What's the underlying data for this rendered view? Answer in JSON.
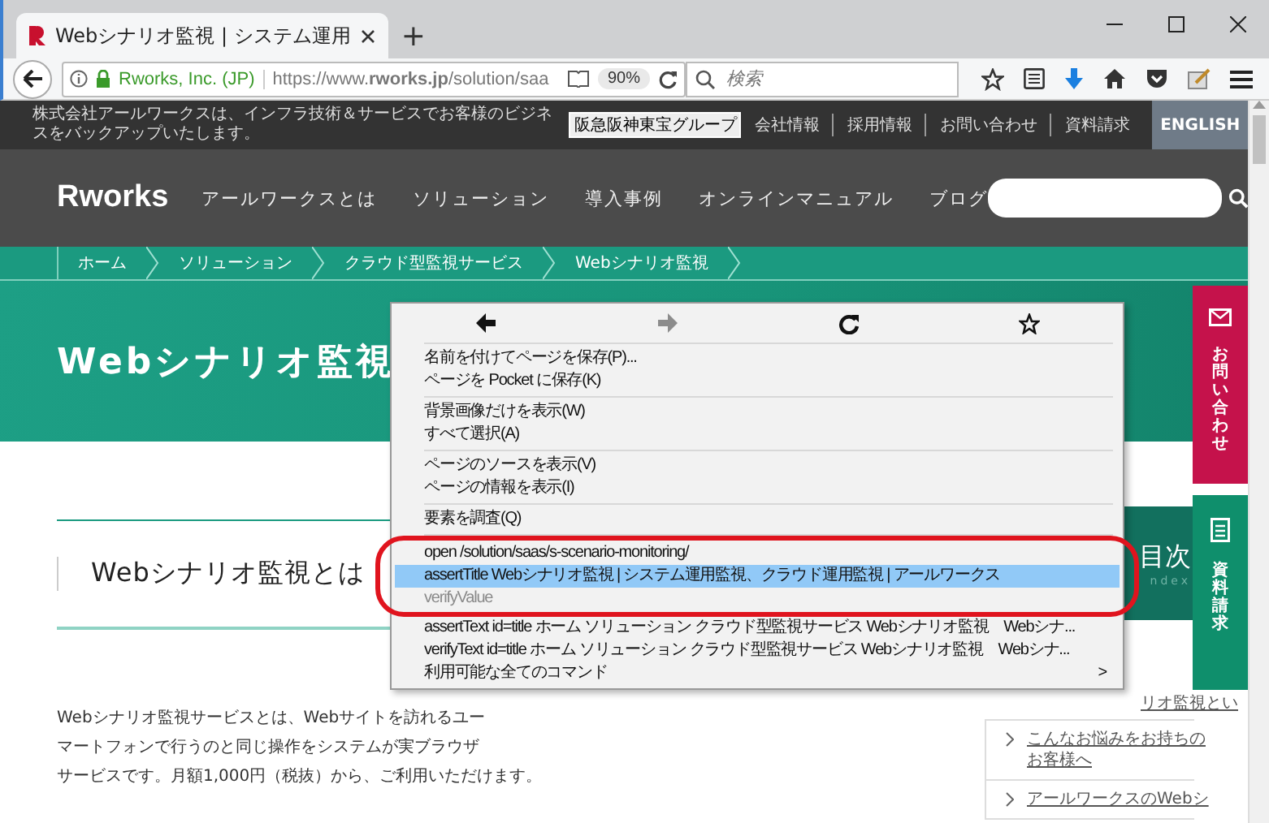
{
  "browser": {
    "tab_title": "Webシナリオ監視 | システム運用",
    "new_tab": "+",
    "site_identity": "Rworks, Inc. (JP)",
    "url": "https://www.**rworks.jp**/solution/saa",
    "zoom": "90%",
    "search_placeholder": "検索"
  },
  "top_bar": {
    "tagline": "株式会社アールワークスは、インフラ技術＆サービスでお客様のビジネスをバックアップいたします。",
    "group_badge": "阪急阪神東宝グループ",
    "links": [
      "会社情報",
      "採用情報",
      "お問い合わせ",
      "資料請求"
    ],
    "language": "ENGLISH"
  },
  "header": {
    "logo": "Rworks",
    "nav": [
      "アールワークスとは",
      "ソリューション",
      "導入事例",
      "オンラインマニュアル",
      "ブログ"
    ]
  },
  "breadcrumb": [
    "ホーム",
    "ソリューション",
    "クラウド型監視サービス",
    "Webシナリオ監視"
  ],
  "hero": {
    "title": "Webシナリオ監視"
  },
  "section": {
    "heading": "Webシナリオ監視とは",
    "paragraph_lines": [
      "Webシナリオ監視サービスとは、Webサイトを訪れるユー",
      "マートフォンで行うのと同じ操作をシステムが実ブラウザ",
      "サービスです。月額1,000円（税抜）から、ご利用いただけます。"
    ]
  },
  "toc": {
    "title": "目次",
    "subtitle": "ndex",
    "items": [
      "リオ監視とい",
      "こんなお悩みをお持ちのお客様へ",
      "アールワークスのWebシ"
    ]
  },
  "side_tabs": [
    {
      "label": "お問い合わせ",
      "kind": "mail",
      "color": "#c5124b"
    },
    {
      "label": "資料請求",
      "kind": "document",
      "color": "#0f8f6c"
    }
  ],
  "context_menu": {
    "nav_buttons": [
      {
        "kind": "back",
        "disabled": false
      },
      {
        "kind": "forward",
        "disabled": true
      },
      {
        "kind": "reload",
        "disabled": false
      },
      {
        "kind": "bookmark",
        "disabled": false
      }
    ],
    "groups": [
      {
        "items": [
          {
            "label": "名前を付けてページを保存(P)...",
            "selected": false,
            "disabled": false,
            "circled": false
          },
          {
            "label": "ページを Pocket に保存(K)",
            "selected": false,
            "disabled": false,
            "circled": false
          }
        ]
      },
      {
        "items": [
          {
            "label": "背景画像だけを表示(W)",
            "selected": false,
            "disabled": false,
            "circled": false
          },
          {
            "label": "すべて選択(A)",
            "selected": false,
            "disabled": false,
            "circled": false
          }
        ]
      },
      {
        "items": [
          {
            "label": "ページのソースを表示(V)",
            "selected": false,
            "disabled": false,
            "circled": false
          },
          {
            "label": "ページの情報を表示(I)",
            "selected": false,
            "disabled": false,
            "circled": false
          }
        ]
      },
      {
        "items": [
          {
            "label": "要素を調査(Q)",
            "selected": false,
            "disabled": false,
            "circled": false
          }
        ]
      },
      {
        "items": [
          {
            "label": "open /solution/saas/s-scenario-monitoring/",
            "selected": false,
            "disabled": false,
            "circled": true
          },
          {
            "label": "assertTitle Webシナリオ監視 | システム運用監視、クラウド運用監視 | アールワークス",
            "selected": true,
            "disabled": false,
            "circled": true
          },
          {
            "label": "verifyValue",
            "selected": false,
            "disabled": true,
            "circled": true
          },
          {
            "label": "assertText id=title ホーム ソリューション クラウド型監視サービス Webシナリオ監視　Webシナ...",
            "selected": false,
            "disabled": false,
            "circled": false
          },
          {
            "label": "verifyText id=title ホーム ソリューション クラウド型監視サービス Webシナリオ監視　Webシナ...",
            "selected": false,
            "disabled": false,
            "circled": false
          },
          {
            "label": "利用可能な全てのコマンド",
            "selected": false,
            "disabled": false,
            "circled": false,
            "arrow": ">"
          }
        ]
      }
    ]
  }
}
